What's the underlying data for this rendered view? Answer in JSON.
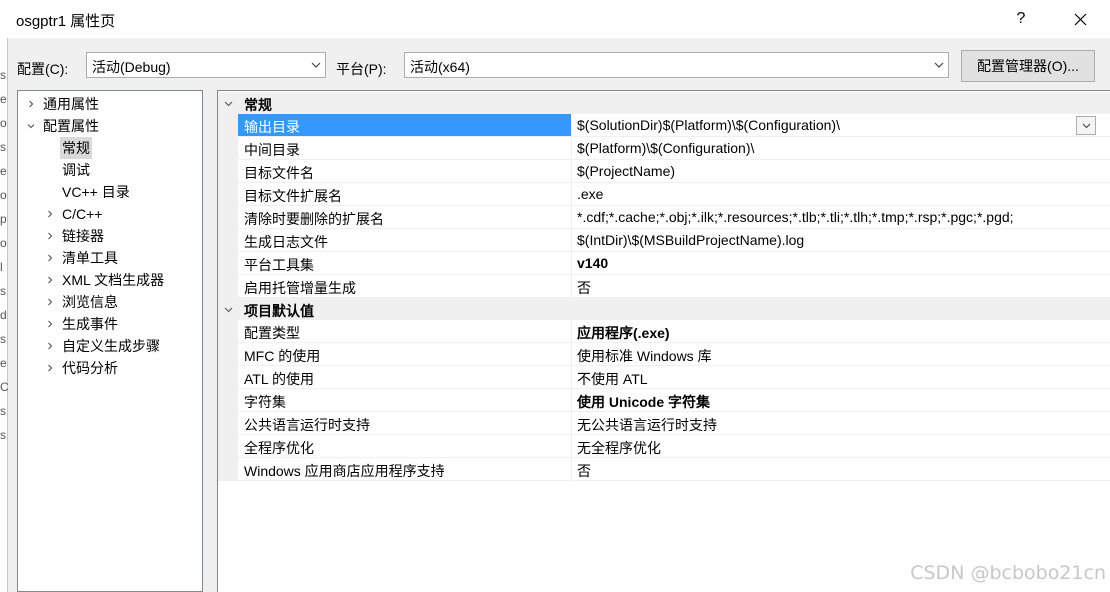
{
  "window": {
    "title": "osgptr1 属性页",
    "help": "?"
  },
  "config": {
    "config_label": "配置(C):",
    "config_value": "活动(Debug)",
    "platform_label": "平台(P):",
    "platform_value": "活动(x64)",
    "manager_button": "配置管理器(O)..."
  },
  "tree": [
    {
      "label": "通用属性",
      "expander": "collapsed"
    },
    {
      "label": "配置属性",
      "expander": "expanded"
    },
    {
      "label": "常规",
      "expander": "none",
      "selected": true
    },
    {
      "label": "调试",
      "expander": "none"
    },
    {
      "label": "VC++ 目录",
      "expander": "none"
    },
    {
      "label": "C/C++",
      "expander": "collapsed"
    },
    {
      "label": "链接器",
      "expander": "collapsed"
    },
    {
      "label": "清单工具",
      "expander": "collapsed"
    },
    {
      "label": "XML 文档生成器",
      "expander": "collapsed"
    },
    {
      "label": "浏览信息",
      "expander": "collapsed"
    },
    {
      "label": "生成事件",
      "expander": "collapsed"
    },
    {
      "label": "自定义生成步骤",
      "expander": "collapsed"
    },
    {
      "label": "代码分析",
      "expander": "collapsed"
    }
  ],
  "grid": {
    "categories": [
      {
        "title": "常规",
        "rows": [
          {
            "name": "输出目录",
            "value": "$(SolutionDir)$(Platform)\\$(Configuration)\\",
            "selected": true
          },
          {
            "name": "中间目录",
            "value": "$(Platform)\\$(Configuration)\\"
          },
          {
            "name": "目标文件名",
            "value": "$(ProjectName)"
          },
          {
            "name": "目标文件扩展名",
            "value": ".exe"
          },
          {
            "name": "清除时要删除的扩展名",
            "value": "*.cdf;*.cache;*.obj;*.ilk;*.resources;*.tlb;*.tli;*.tlh;*.tmp;*.rsp;*.pgc;*.pgd;"
          },
          {
            "name": "生成日志文件",
            "value": "$(IntDir)\\$(MSBuildProjectName).log"
          },
          {
            "name": "平台工具集",
            "value": "v140",
            "bold": true
          },
          {
            "name": "启用托管增量生成",
            "value": "否"
          }
        ]
      },
      {
        "title": "项目默认值",
        "rows": [
          {
            "name": "配置类型",
            "value": "应用程序(.exe)",
            "bold": true
          },
          {
            "name": "MFC 的使用",
            "value": "使用标准 Windows 库"
          },
          {
            "name": "ATL 的使用",
            "value": "不使用 ATL"
          },
          {
            "name": "字符集",
            "value": "使用 Unicode 字符集",
            "bold": true
          },
          {
            "name": "公共语言运行时支持",
            "value": "无公共语言运行时支持"
          },
          {
            "name": "全程序优化",
            "value": "无全程序优化"
          },
          {
            "name": "Windows 应用商店应用程序支持",
            "value": "否"
          }
        ]
      }
    ]
  },
  "background_fragments": [
    "s",
    "e",
    "o",
    "s",
    "e",
    "o",
    "p",
    "o",
    "l",
    "s",
    "d",
    "s",
    "e",
    "C",
    "s",
    "s"
  ],
  "watermark": "CSDN @bcbobo21cn",
  "colors": {
    "selection": "#3399ff",
    "tree_selection": "#d9d9d9",
    "dialog_bg": "#f0f0f0"
  }
}
